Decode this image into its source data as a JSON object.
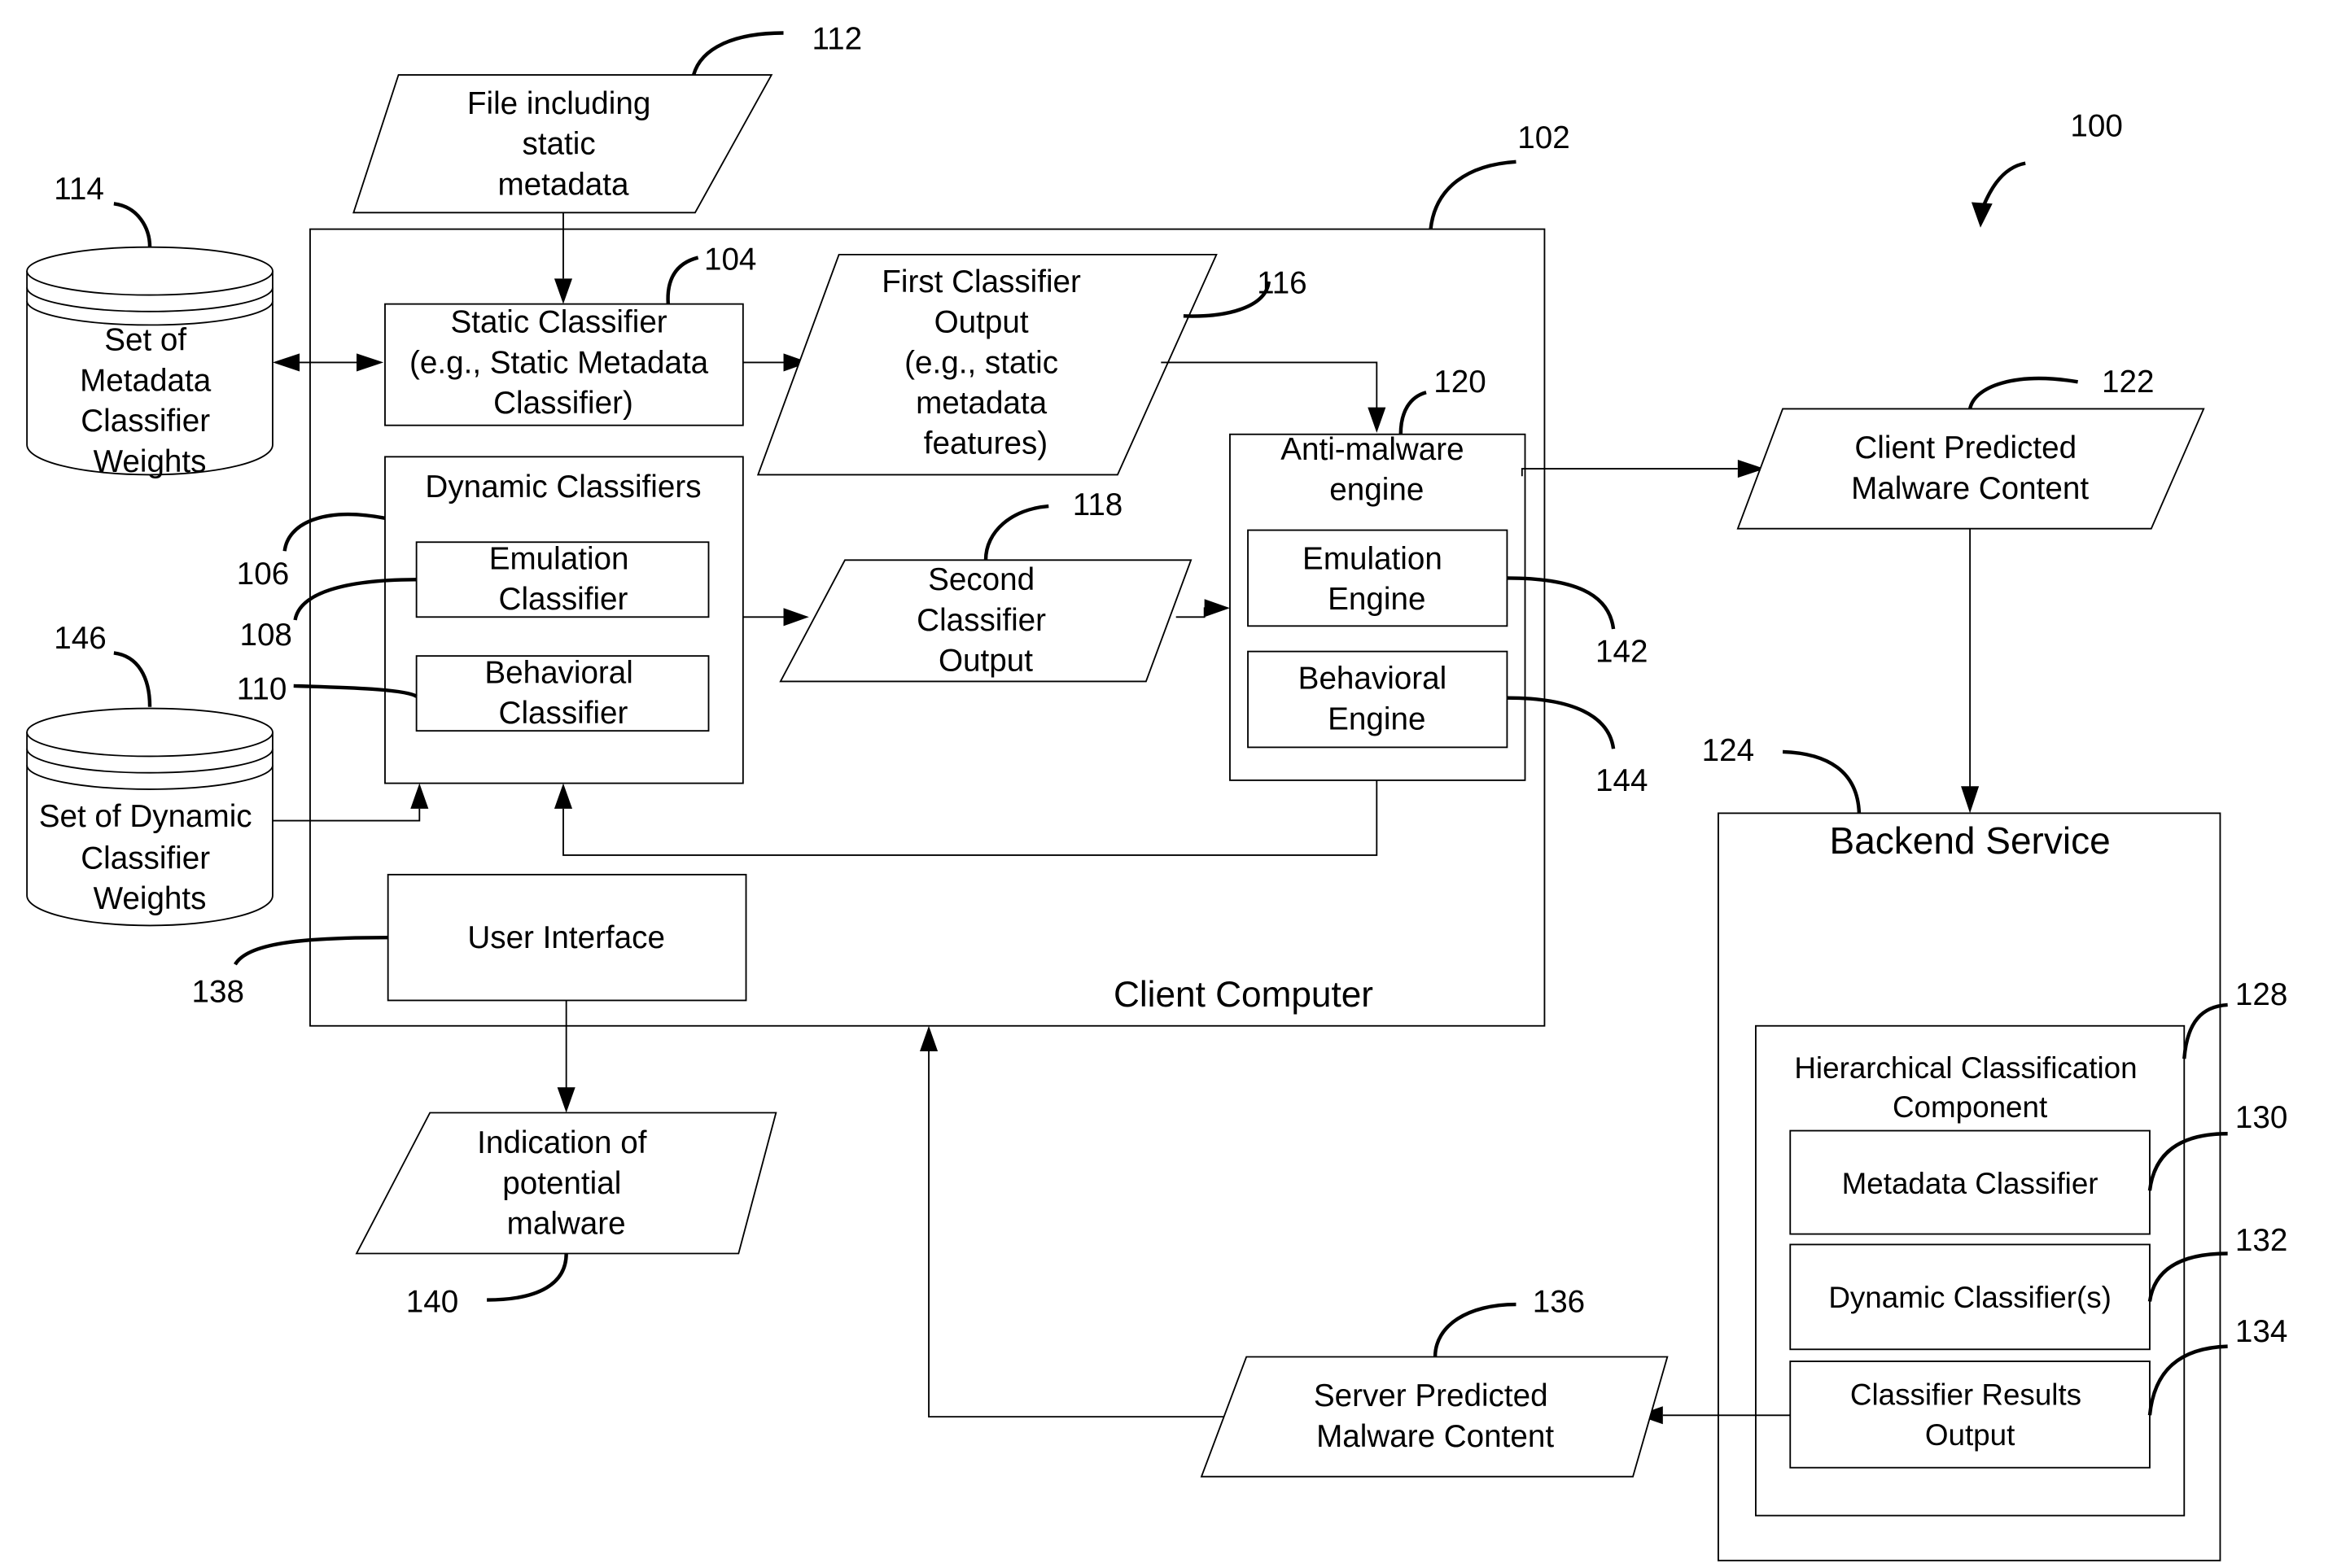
{
  "figure_number": "100",
  "nodes": {
    "file_input": {
      "ref": "112",
      "lines": [
        "File including",
        "static",
        "metadata"
      ]
    },
    "metadata_weights_db": {
      "ref": "114",
      "lines": [
        "Set of",
        "Metadata",
        "Classifier",
        "Weights"
      ]
    },
    "dynamic_weights_db": {
      "ref": "146",
      "lines": [
        "Set of Dynamic",
        "Classifier",
        "Weights"
      ]
    },
    "client_computer": {
      "ref": "102",
      "label": "Client Computer"
    },
    "static_classifier": {
      "ref": "104",
      "lines": [
        "Static Classifier",
        "(e.g., Static Metadata",
        "Classifier)"
      ]
    },
    "dynamic_classifiers": {
      "ref": "106",
      "label": "Dynamic Classifiers"
    },
    "emulation_classifier": {
      "ref": "108",
      "lines": [
        "Emulation",
        "Classifier"
      ]
    },
    "behavioral_classifier": {
      "ref": "110",
      "lines": [
        "Behavioral",
        "Classifier"
      ]
    },
    "first_output": {
      "ref": "116",
      "lines": [
        "First Classifier",
        "Output",
        "(e.g., static",
        "metadata",
        "features)"
      ]
    },
    "second_output": {
      "ref": "118",
      "lines": [
        "Second",
        "Classifier",
        "Output"
      ]
    },
    "anti_malware_engine": {
      "ref": "120",
      "lines": [
        "Anti-malware",
        "engine"
      ]
    },
    "emulation_engine": {
      "ref": "142",
      "lines": [
        "Emulation",
        "Engine"
      ]
    },
    "behavioral_engine": {
      "ref": "144",
      "lines": [
        "Behavioral",
        "Engine"
      ]
    },
    "user_interface": {
      "ref": "138",
      "label": "User Interface"
    },
    "indication": {
      "ref": "140",
      "lines": [
        "Indication of",
        "potential",
        "malware"
      ]
    },
    "client_predicted": {
      "ref": "122",
      "lines": [
        "Client Predicted",
        "Malware Content"
      ]
    },
    "backend_service": {
      "ref": "124",
      "label": "Backend Service"
    },
    "hierarchical_component": {
      "ref": "128",
      "lines": [
        "Hierarchical Classification",
        "Component"
      ]
    },
    "metadata_classifier": {
      "ref": "130",
      "label": "Metadata Classifier"
    },
    "dynamic_classifiers_backend": {
      "ref": "132",
      "label": "Dynamic Classifier(s)"
    },
    "classifier_results": {
      "ref": "134",
      "lines": [
        "Classifier Results",
        "Output"
      ]
    },
    "server_predicted": {
      "ref": "136",
      "lines": [
        "Server Predicted",
        "Malware Content"
      ]
    }
  }
}
